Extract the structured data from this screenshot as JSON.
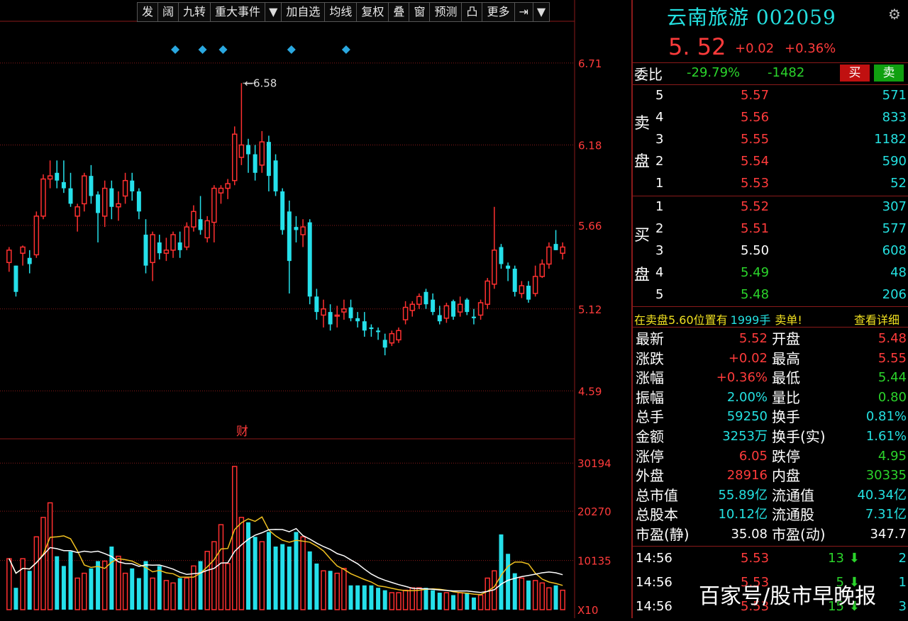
{
  "toolbar": {
    "items": [
      "发",
      "阔",
      "九转",
      "重大事件",
      "▼",
      "加自选",
      "均线",
      "复权",
      "叠",
      "窗",
      "预测",
      "凸",
      "更多",
      "⇥",
      "▼"
    ]
  },
  "chart": {
    "price_axis": [
      "6.71",
      "6.18",
      "5.66",
      "5.12",
      "4.59"
    ],
    "volume_axis": [
      "30194",
      "20270",
      "10135",
      "X10"
    ],
    "high_label": "6.58",
    "event_label": "财",
    "colors": {
      "up": "#ff3030",
      "down": "#25e0ea",
      "ma5": "#ffffff",
      "ma10": "#f0c020",
      "grid": "#8a1a1a",
      "marker": "#2aa8e0"
    }
  },
  "chart_data": {
    "type": "candlestick",
    "title": "",
    "ylim": [
      4.28,
      6.98
    ],
    "volume_ylim": [
      0,
      33000
    ],
    "candles": [
      [
        5.42,
        5.52,
        5.36,
        5.5
      ],
      [
        5.4,
        5.4,
        5.2,
        5.23
      ],
      [
        5.48,
        5.53,
        5.4,
        5.52
      ],
      [
        5.45,
        5.5,
        5.35,
        5.41
      ],
      [
        5.47,
        5.75,
        5.45,
        5.72
      ],
      [
        5.72,
        5.99,
        5.7,
        5.96
      ],
      [
        5.96,
        6.08,
        5.9,
        5.98
      ],
      [
        6.0,
        6.08,
        5.9,
        5.95
      ],
      [
        5.94,
        6.08,
        5.87,
        5.9
      ],
      [
        5.9,
        6.0,
        5.78,
        5.8
      ],
      [
        5.72,
        5.8,
        5.62,
        5.78
      ],
      [
        5.8,
        6.0,
        5.75,
        5.98
      ],
      [
        5.98,
        6.05,
        5.8,
        5.85
      ],
      [
        5.86,
        5.88,
        5.55,
        5.74
      ],
      [
        5.72,
        5.95,
        5.65,
        5.9
      ],
      [
        5.9,
        5.95,
        5.7,
        5.78
      ],
      [
        5.78,
        5.88,
        5.69,
        5.8
      ],
      [
        5.85,
        6.0,
        5.8,
        5.95
      ],
      [
        5.95,
        6.0,
        5.82,
        5.88
      ],
      [
        5.88,
        5.9,
        5.7,
        5.75
      ],
      [
        5.6,
        5.7,
        5.35,
        5.4
      ],
      [
        5.42,
        5.62,
        5.3,
        5.6
      ],
      [
        5.55,
        5.6,
        5.44,
        5.48
      ],
      [
        5.48,
        5.58,
        5.43,
        5.5
      ],
      [
        5.5,
        5.62,
        5.45,
        5.6
      ],
      [
        5.55,
        5.62,
        5.45,
        5.5
      ],
      [
        5.52,
        5.68,
        5.5,
        5.65
      ],
      [
        5.65,
        5.79,
        5.62,
        5.75
      ],
      [
        5.7,
        5.85,
        5.6,
        5.63
      ],
      [
        5.58,
        5.72,
        5.55,
        5.69
      ],
      [
        5.68,
        5.92,
        5.55,
        5.9
      ],
      [
        5.87,
        5.92,
        5.8,
        5.9
      ],
      [
        5.9,
        5.96,
        5.83,
        5.93
      ],
      [
        5.95,
        6.3,
        5.92,
        6.25
      ],
      [
        6.1,
        6.58,
        6.05,
        6.18
      ],
      [
        6.18,
        6.22,
        6.0,
        6.12
      ],
      [
        6.12,
        6.18,
        5.95,
        6.0
      ],
      [
        6.05,
        6.27,
        6.0,
        6.2
      ],
      [
        6.2,
        6.24,
        5.88,
        5.98
      ],
      [
        6.08,
        6.12,
        5.85,
        5.88
      ],
      [
        5.88,
        5.9,
        5.6,
        5.63
      ],
      [
        5.75,
        5.82,
        5.22,
        5.43
      ],
      [
        5.65,
        5.72,
        5.55,
        5.63
      ],
      [
        5.6,
        5.7,
        5.52,
        5.65
      ],
      [
        5.68,
        5.7,
        5.15,
        5.2
      ],
      [
        5.2,
        5.25,
        5.05,
        5.1
      ],
      [
        5.08,
        5.18,
        5.0,
        5.12
      ],
      [
        5.1,
        5.15,
        4.98,
        5.02
      ],
      [
        5.08,
        5.14,
        5.0,
        5.08
      ],
      [
        5.1,
        5.18,
        5.05,
        5.12
      ],
      [
        5.13,
        5.18,
        5.04,
        5.06
      ],
      [
        5.06,
        5.1,
        5.0,
        5.04
      ],
      [
        5.04,
        5.1,
        4.94,
        4.98
      ],
      [
        5.0,
        5.02,
        4.94,
        4.99
      ],
      [
        4.98,
        5.0,
        4.92,
        4.97
      ],
      [
        4.92,
        4.96,
        4.82,
        4.87
      ],
      [
        4.9,
        4.98,
        4.88,
        4.96
      ],
      [
        4.92,
        5.0,
        4.9,
        4.98
      ],
      [
        5.05,
        5.17,
        5.02,
        5.13
      ],
      [
        5.11,
        5.17,
        5.07,
        5.15
      ],
      [
        5.15,
        5.22,
        5.12,
        5.2
      ],
      [
        5.23,
        5.25,
        5.12,
        5.15
      ],
      [
        5.18,
        5.22,
        5.08,
        5.1
      ],
      [
        5.08,
        5.14,
        5.02,
        5.04
      ],
      [
        5.06,
        5.16,
        5.03,
        5.14
      ],
      [
        5.17,
        5.18,
        5.05,
        5.07
      ],
      [
        5.1,
        5.2,
        5.07,
        5.15
      ],
      [
        5.18,
        5.19,
        5.08,
        5.1
      ],
      [
        5.07,
        5.12,
        5.02,
        5.06
      ],
      [
        5.08,
        5.18,
        5.05,
        5.16
      ],
      [
        5.15,
        5.32,
        5.12,
        5.3
      ],
      [
        5.28,
        5.78,
        5.25,
        5.5
      ],
      [
        5.52,
        5.54,
        5.38,
        5.41
      ],
      [
        5.4,
        5.42,
        5.3,
        5.38
      ],
      [
        5.38,
        5.4,
        5.2,
        5.23
      ],
      [
        5.22,
        5.3,
        5.19,
        5.27
      ],
      [
        5.27,
        5.3,
        5.16,
        5.18
      ],
      [
        5.22,
        5.4,
        5.2,
        5.33
      ],
      [
        5.33,
        5.44,
        5.32,
        5.41
      ],
      [
        5.41,
        5.55,
        5.38,
        5.52
      ],
      [
        5.54,
        5.63,
        5.5,
        5.5
      ],
      [
        5.48,
        5.55,
        5.44,
        5.52
      ]
    ],
    "volume": [
      10500,
      4500,
      10500,
      8000,
      15000,
      19000,
      22000,
      11000,
      9000,
      12000,
      6500,
      7500,
      8500,
      10000,
      10000,
      13000,
      11000,
      7500,
      8500,
      6500,
      10000,
      6500,
      9000,
      6000,
      5500,
      6500,
      6500,
      9000,
      10000,
      12000,
      14000,
      17500,
      9500,
      29500,
      19000,
      18000,
      15000,
      14000,
      16000,
      13000,
      13500,
      13000,
      16000,
      15000,
      12000,
      9500,
      8000,
      8000,
      7500,
      8500,
      5000,
      5000,
      5000,
      5000,
      4500,
      4000,
      3500,
      3500,
      4000,
      4500,
      4500,
      4500,
      4000,
      3500,
      3500,
      3000,
      3500,
      3500,
      2500,
      3000,
      6500,
      8000,
      15500,
      11500,
      7500,
      6500,
      6000,
      6000,
      5500,
      4500,
      5000,
      4000
    ],
    "ma5": [
      5.55,
      5.52,
      5.47,
      5.42,
      5.48,
      5.58,
      5.73,
      5.87,
      5.94,
      5.93,
      5.88,
      5.87,
      5.85,
      5.83,
      5.84,
      5.84,
      5.83,
      5.82,
      5.85,
      5.83,
      5.75,
      5.7,
      5.63,
      5.56,
      5.52,
      5.54,
      5.55,
      5.6,
      5.63,
      5.69,
      5.74,
      5.8,
      5.85,
      5.96,
      6.07,
      6.12,
      6.16,
      6.16,
      6.1,
      6.04,
      5.94,
      5.82,
      5.71,
      5.65,
      5.59,
      5.4,
      5.35,
      5.3,
      5.2,
      5.09,
      5.08,
      5.07,
      5.05,
      5.04,
      5.01,
      4.97,
      4.95,
      4.95,
      4.98,
      5.02,
      5.08,
      5.12,
      5.15,
      5.14,
      5.13,
      5.1,
      5.09,
      5.1,
      5.11,
      5.11,
      5.13,
      5.19,
      5.29,
      5.37,
      5.37,
      5.36,
      5.3,
      5.28,
      5.28,
      5.33,
      5.4,
      5.45
    ],
    "ma10": [
      5.6,
      5.58,
      5.55,
      5.52,
      5.5,
      5.52,
      5.58,
      5.65,
      5.7,
      5.72,
      5.74,
      5.78,
      5.82,
      5.86,
      5.88,
      5.88,
      5.86,
      5.84,
      5.84,
      5.83,
      5.8,
      5.76,
      5.72,
      5.68,
      5.64,
      5.62,
      5.62,
      5.62,
      5.62,
      5.62,
      5.64,
      5.67,
      5.71,
      5.76,
      5.81,
      5.86,
      5.91,
      5.96,
      6.0,
      6.04,
      6.02,
      5.98,
      5.92,
      5.86,
      5.8,
      5.71,
      5.61,
      5.51,
      5.43,
      5.36,
      5.3,
      5.24,
      5.18,
      5.13,
      5.07,
      5.04,
      5.02,
      5.0,
      4.99,
      4.99,
      5.0,
      5.02,
      5.04,
      5.06,
      5.08,
      5.09,
      5.1,
      5.11,
      5.12,
      5.12,
      5.13,
      5.15,
      5.19,
      5.22,
      5.23,
      5.24,
      5.24,
      5.25,
      5.26,
      5.28,
      5.3,
      5.32
    ],
    "markers_index": [
      24,
      28,
      31,
      41,
      49
    ],
    "high_index": 34
  },
  "stock": {
    "name": "云南旅游 002059",
    "price": "5. 52",
    "change": "+0.02",
    "change_pct": "+0.36%",
    "gear_icon": "gear-icon"
  },
  "weibi": {
    "label": "委比",
    "ratio": "-29.79%",
    "diff": "-1482",
    "buy_label": "买",
    "sell_label": "卖"
  },
  "sell_book": {
    "label": "卖盘",
    "rows": [
      {
        "level": "5",
        "price": "5.57",
        "vol": "571"
      },
      {
        "level": "4",
        "price": "5.56",
        "vol": "833"
      },
      {
        "level": "3",
        "price": "5.55",
        "vol": "1182"
      },
      {
        "level": "2",
        "price": "5.54",
        "vol": "590"
      },
      {
        "level": "1",
        "price": "5.53",
        "vol": "52"
      }
    ]
  },
  "buy_book": {
    "label": "买盘",
    "rows": [
      {
        "level": "1",
        "price": "5.52",
        "vol": "307"
      },
      {
        "level": "2",
        "price": "5.51",
        "vol": "577"
      },
      {
        "level": "3",
        "price": "5.50",
        "vol": "608"
      },
      {
        "level": "4",
        "price": "5.49",
        "vol": "48"
      },
      {
        "level": "5",
        "price": "5.48",
        "vol": "206"
      }
    ]
  },
  "alert": {
    "text_a": "在卖盘5.60位置有",
    "text_b": "1999手",
    "text_c": "卖单!",
    "link": "查看详细"
  },
  "quote": {
    "rows": [
      {
        "l1": "最新",
        "v1": "5.52",
        "l2": "开盘",
        "v2": "5.48"
      },
      {
        "l1": "涨跌",
        "v1": "+0.02",
        "l2": "最高",
        "v2": "5.55"
      },
      {
        "l1": "涨幅",
        "v1": "+0.36%",
        "l2": "最低",
        "v2": "5.44"
      },
      {
        "l1": "振幅",
        "v1": "2.00%",
        "l2": "量比",
        "v2": "0.80"
      },
      {
        "l1": "总手",
        "v1": "59250",
        "l2": "换手",
        "v2": "0.81%"
      },
      {
        "l1": "金额",
        "v1": "3253万",
        "l2": "换手(实)",
        "v2": "1.61%"
      },
      {
        "l1": "涨停",
        "v1": "6.05",
        "l2": "跌停",
        "v2": "4.95"
      },
      {
        "l1": "外盘",
        "v1": "28916",
        "l2": "内盘",
        "v2": "30335"
      },
      {
        "l1": "总市值",
        "v1": "55.89亿",
        "l2": "流通值",
        "v2": "40.34亿"
      },
      {
        "l1": "总股本",
        "v1": "10.12亿",
        "l2": "流通股",
        "v2": "7.31亿"
      },
      {
        "l1": "市盈(静)",
        "v1": "35.08",
        "l2": "市盈(动)",
        "v2": "347.7"
      }
    ]
  },
  "ticks": {
    "rows": [
      {
        "time": "14:56",
        "price": "5.53",
        "vol": "13",
        "n": "2"
      },
      {
        "time": "14:56",
        "price": "5.53",
        "vol": "5",
        "n": "1"
      },
      {
        "time": "14:56",
        "price": "5.53",
        "vol": "15",
        "n": "3"
      }
    ]
  },
  "watermark": "百家号/股市早晚报"
}
